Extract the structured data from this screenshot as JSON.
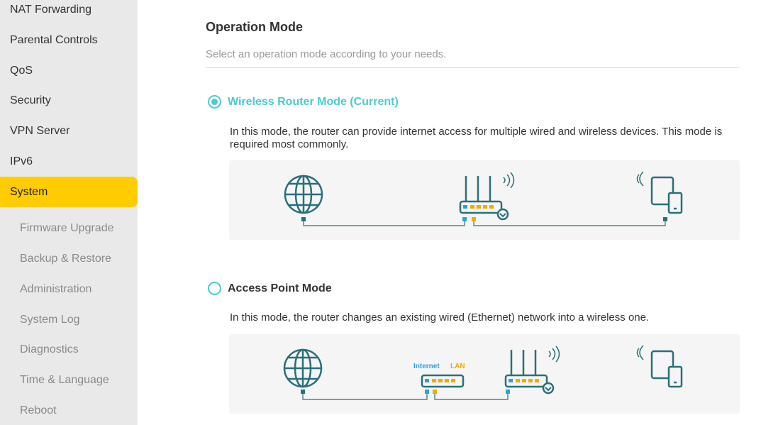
{
  "sidebar": {
    "items": [
      {
        "label": "NAT Forwarding"
      },
      {
        "label": "Parental Controls"
      },
      {
        "label": "QoS"
      },
      {
        "label": "Security"
      },
      {
        "label": "VPN Server"
      },
      {
        "label": "IPv6"
      },
      {
        "label": "System",
        "active": true
      }
    ],
    "subitems": [
      {
        "label": "Firmware Upgrade"
      },
      {
        "label": "Backup & Restore"
      },
      {
        "label": "Administration"
      },
      {
        "label": "System Log"
      },
      {
        "label": "Diagnostics"
      },
      {
        "label": "Time & Language"
      },
      {
        "label": "Reboot"
      }
    ]
  },
  "main": {
    "title": "Operation Mode",
    "subtitle": "Select an operation mode according to your needs.",
    "modes": [
      {
        "label": "Wireless Router Mode (Current)",
        "selected": true,
        "description": "In this mode, the router can provide internet access for multiple wired and wireless devices. This mode is required most commonly."
      },
      {
        "label": "Access Point Mode",
        "selected": false,
        "description": "In this mode, the router changes an existing wired (Ethernet) network into a wireless one."
      }
    ],
    "ap_diagram": {
      "internet_label": "Internet",
      "lan_label": "LAN"
    }
  },
  "colors": {
    "accent": "#4acbd6",
    "active_nav": "#ffcc00",
    "icon_teal": "#2b6f7a",
    "lan_yellow": "#f5a800",
    "wan_blue": "#2ea0d8"
  }
}
